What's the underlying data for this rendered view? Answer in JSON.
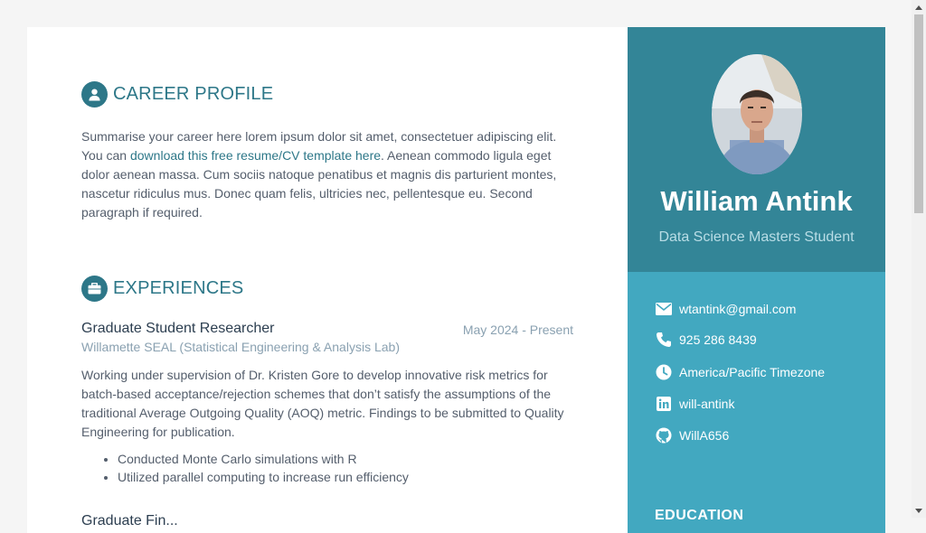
{
  "career": {
    "heading": "CAREER PROFILE",
    "text_before_link": "Summarise your career here lorem ipsum dolor sit amet, consectetuer adipiscing elit. You can ",
    "link_text": "download this free resume/CV template here",
    "text_after_link": ". Aenean commodo ligula eget dolor aenean massa. Cum sociis natoque penatibus et magnis dis parturient montes, nascetur ridiculus mus. Donec quam felis, ultricies nec, pellentesque eu. Second paragraph if required."
  },
  "experiences": {
    "heading": "EXPERIENCES",
    "items": [
      {
        "title": "Graduate Student Researcher",
        "date": "May 2024 - Present",
        "company": "Willamette SEAL (Statistical Engineering & Analysis Lab)",
        "description": "Working under supervision of Dr. Kristen Gore to develop innovative risk metrics for batch-based acceptance/rejection schemes that don’t satisfy the assumptions of the traditional Average Outgoing Quality (AOQ) metric. Findings to be submitted to Quality Engineering for publication.",
        "bullets": [
          "Conducted Monte Carlo simulations with R",
          "Utilized parallel computing to increase run efficiency"
        ]
      }
    ],
    "next_title_partial": "Graduate Fin..."
  },
  "sidebar": {
    "name": "William Antink",
    "tagline": "Data Science Masters Student",
    "contacts": {
      "email": "wtantink@gmail.com",
      "phone": "925 286 8439",
      "timezone": "America/Pacific Timezone",
      "linkedin": "will-antink",
      "github": "WillA656"
    },
    "education_heading": "EDUCATION"
  },
  "colors": {
    "accent": "#2d7788",
    "sidebar_top": "#338597",
    "sidebar": "#42a8c0",
    "muted": "#8aa1b1"
  }
}
